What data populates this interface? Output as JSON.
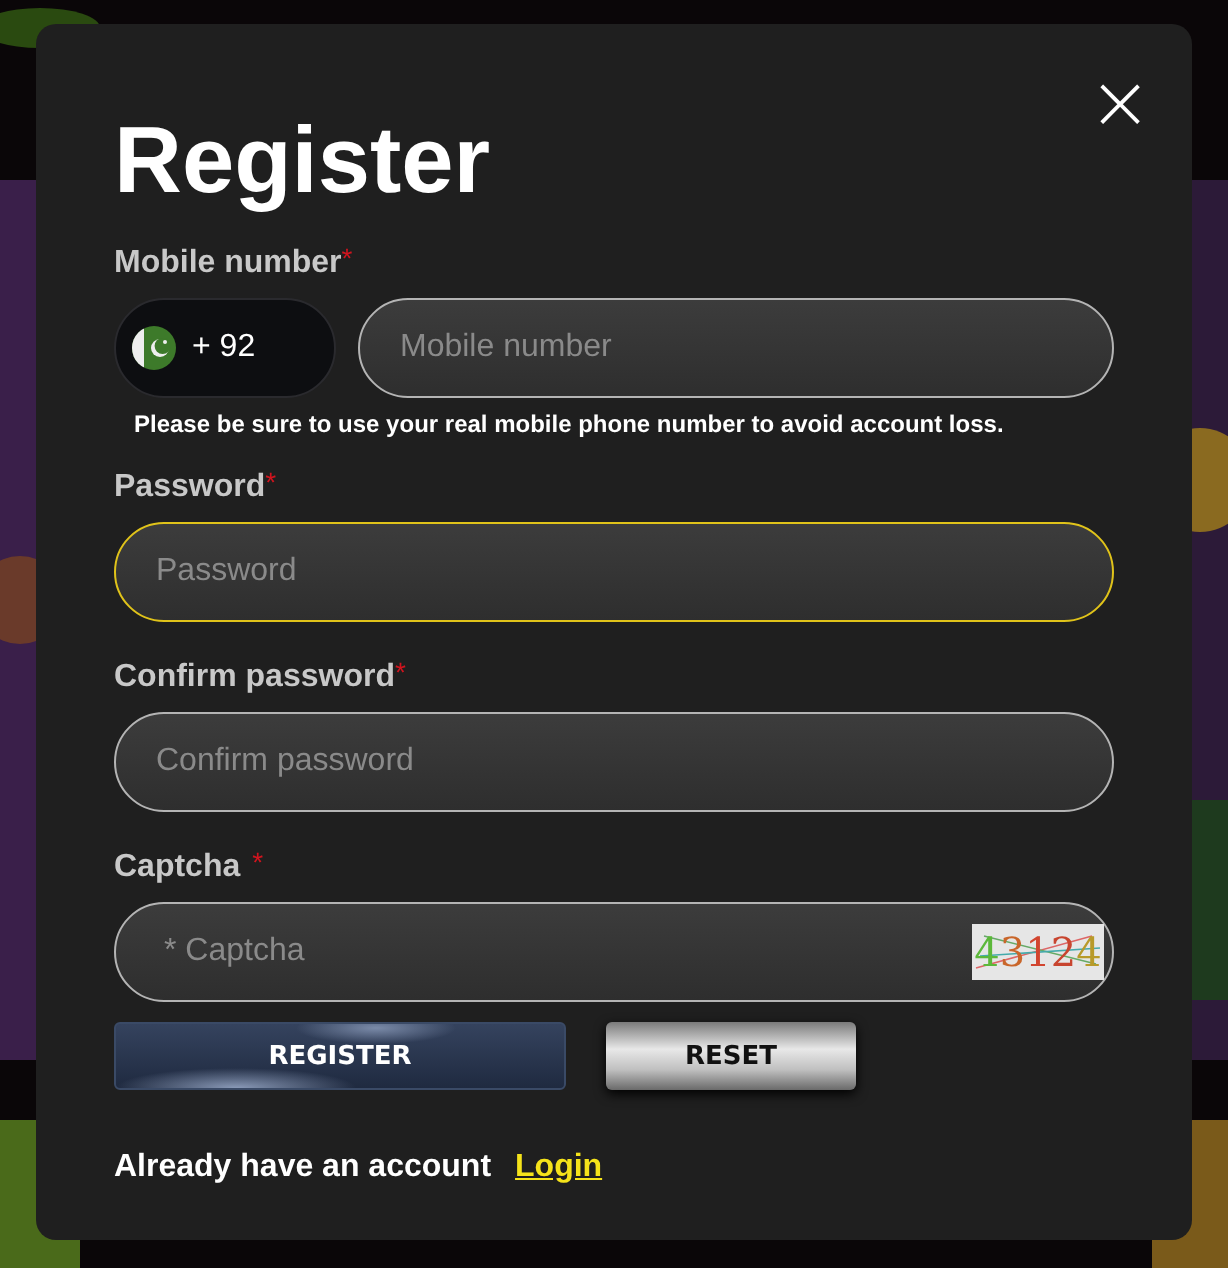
{
  "dialog": {
    "title": "Register",
    "close": "×"
  },
  "fields": [
    {
      "kind": "phone",
      "label": "Mobile number",
      "required": "*",
      "code": "+ 92",
      "placeholder": "Mobile number",
      "focused": false,
      "note": "Please be sure to use your real mobile phone number to avoid account loss."
    },
    {
      "kind": "text",
      "label": "Password",
      "required": "*",
      "placeholder": "Password",
      "focused": true
    },
    {
      "kind": "text",
      "label": "Confirm password",
      "required": "*",
      "placeholder": "Confirm password",
      "focused": false
    },
    {
      "kind": "captcha",
      "label": "Captcha",
      "required": "*",
      "placeholder": "* Captcha",
      "focused": false,
      "captcha": "43124"
    }
  ],
  "buttons": [
    {
      "kind": "primary",
      "label": "REGISTER"
    },
    {
      "kind": "secondary",
      "label": "RESET"
    }
  ],
  "footer": {
    "text": "Already have an account",
    "link": "Login"
  }
}
